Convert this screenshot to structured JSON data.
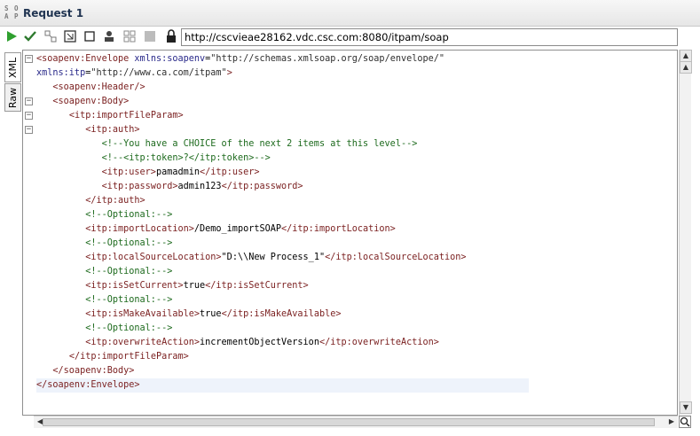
{
  "titlebar": {
    "icon_text": "SOAP",
    "title": "Request 1"
  },
  "toolbar": {
    "buttons": [
      "run-icon",
      "validate-icon",
      "format-icon",
      "expand-icon",
      "checkbox-icon",
      "user-icon",
      "settings-icon",
      "stop-icon",
      "lock-icon"
    ],
    "url": "http://cscvieae28162.vdc.csc.com:8080/itpam/soap"
  },
  "sidetabs": {
    "xml_label": "XML",
    "raw_label": "Raw"
  },
  "editor": {
    "lines": [
      {
        "indent": 0,
        "parts": [
          [
            "tag",
            "<soapenv:Envelope"
          ],
          [
            "text",
            " "
          ],
          [
            "attr",
            "xmlns:soapenv"
          ],
          [
            "text",
            "="
          ],
          [
            "str",
            "\"http://schemas.xmlsoap.org/soap/envelope/\""
          ]
        ]
      },
      {
        "indent": 0,
        "parts": [
          [
            "attr",
            "xmlns:itp"
          ],
          [
            "text",
            "="
          ],
          [
            "str",
            "\"http://www.ca.com/itpam\""
          ],
          [
            "tag",
            ">"
          ]
        ]
      },
      {
        "indent": 3,
        "parts": [
          [
            "tag",
            "<soapenv:Header/>"
          ]
        ]
      },
      {
        "indent": 3,
        "parts": [
          [
            "tag",
            "<soapenv:Body>"
          ]
        ]
      },
      {
        "indent": 6,
        "parts": [
          [
            "tag",
            "<itp:importFileParam>"
          ]
        ]
      },
      {
        "indent": 9,
        "parts": [
          [
            "tag",
            "<itp:auth>"
          ]
        ]
      },
      {
        "indent": 12,
        "parts": [
          [
            "comment",
            "<!--You have a CHOICE of the next 2 items at this level-->"
          ]
        ]
      },
      {
        "indent": 12,
        "parts": [
          [
            "comment",
            "<!--<itp:token>?</itp:token>-->"
          ]
        ]
      },
      {
        "indent": 12,
        "parts": [
          [
            "tag",
            "<itp:user>"
          ],
          [
            "text",
            "pamadmin"
          ],
          [
            "tag",
            "</itp:user>"
          ]
        ]
      },
      {
        "indent": 12,
        "parts": [
          [
            "tag",
            "<itp:password>"
          ],
          [
            "text",
            "admin123"
          ],
          [
            "tag",
            "</itp:password>"
          ]
        ]
      },
      {
        "indent": 9,
        "parts": [
          [
            "tag",
            "</itp:auth>"
          ]
        ]
      },
      {
        "indent": 9,
        "parts": [
          [
            "comment",
            "<!--Optional:-->"
          ]
        ]
      },
      {
        "indent": 9,
        "parts": [
          [
            "tag",
            "<itp:importLocation>"
          ],
          [
            "text",
            "/Demo_importSOAP"
          ],
          [
            "tag",
            "</itp:importLocation>"
          ]
        ]
      },
      {
        "indent": 9,
        "parts": [
          [
            "comment",
            "<!--Optional:-->"
          ]
        ]
      },
      {
        "indent": 9,
        "parts": [
          [
            "tag",
            "<itp:localSourceLocation>"
          ],
          [
            "text",
            "\"D:\\\\New Process_1\""
          ],
          [
            "tag",
            "</itp:localSourceLocation>"
          ]
        ]
      },
      {
        "indent": 9,
        "parts": [
          [
            "comment",
            "<!--Optional:-->"
          ]
        ]
      },
      {
        "indent": 9,
        "parts": [
          [
            "tag",
            "<itp:isSetCurrent>"
          ],
          [
            "text",
            "true"
          ],
          [
            "tag",
            "</itp:isSetCurrent>"
          ]
        ]
      },
      {
        "indent": 9,
        "parts": [
          [
            "comment",
            "<!--Optional:-->"
          ]
        ]
      },
      {
        "indent": 9,
        "parts": [
          [
            "tag",
            "<itp:isMakeAvailable>"
          ],
          [
            "text",
            "true"
          ],
          [
            "tag",
            "</itp:isMakeAvailable>"
          ]
        ]
      },
      {
        "indent": 9,
        "parts": [
          [
            "comment",
            "<!--Optional:-->"
          ]
        ]
      },
      {
        "indent": 9,
        "parts": [
          [
            "tag",
            "<itp:overwriteAction>"
          ],
          [
            "text",
            "incrementObjectVersion"
          ],
          [
            "tag",
            "</itp:overwriteAction>"
          ]
        ]
      },
      {
        "indent": 6,
        "parts": [
          [
            "tag",
            "</itp:importFileParam>"
          ]
        ]
      },
      {
        "indent": 3,
        "parts": [
          [
            "tag",
            "</soapenv:Body>"
          ]
        ]
      },
      {
        "indent": 0,
        "parts": [
          [
            "tag",
            "</soapenv:Envelope>"
          ]
        ]
      }
    ],
    "fold_markers": [
      0,
      3,
      4,
      5
    ]
  }
}
